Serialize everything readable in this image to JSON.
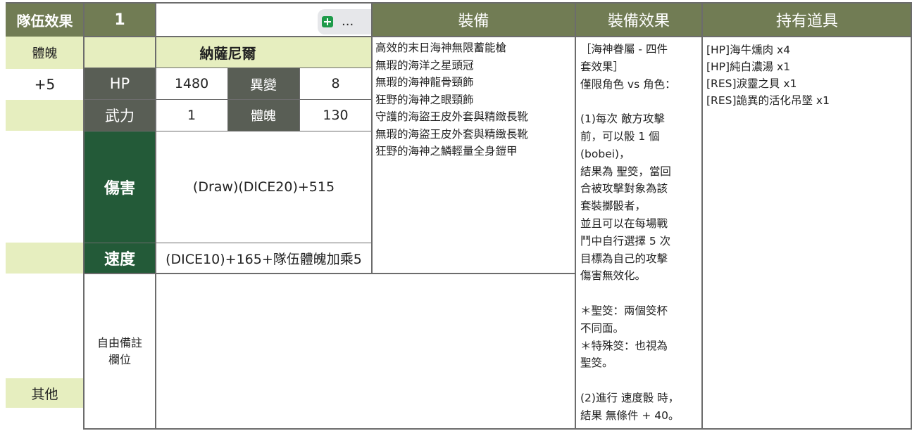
{
  "header": {
    "team_effect": "隊伍效果",
    "value": "1",
    "more": "...",
    "equipment": "裝備",
    "equip_effect": "裝備效果",
    "items": "持有道具"
  },
  "left_col": {
    "stat_label": "體魄",
    "stat_value": "+5",
    "other_label": "其他"
  },
  "character": {
    "name": "納薩尼爾",
    "hp_label": "HP",
    "hp_value": "1480",
    "mutation_label": "異變",
    "mutation_value": "8",
    "force_label": "武力",
    "force_value": "1",
    "body_label": "體魄",
    "body_value": "130",
    "damage_label": "傷害",
    "damage_value": "(Draw)(DICE20)+515",
    "speed_label": "速度",
    "speed_value": "(DICE10)+165+隊伍體魄加乘5",
    "notes_label": "自由備註\n欄位"
  },
  "equipment": [
    "高效的末日海神無限蓄能槍",
    "無瑕的海洋之星頭冠",
    "無瑕的海神龍骨頸飾",
    "狂野的海神之眼頸飾",
    "守護的海盜王皮外套與精緻長靴",
    "無瑕的海盜王皮外套與精緻長靴",
    "狂野的海神之鱗輕量全身鎧甲"
  ],
  "equip_effect_text": "［海神眷屬 - 四件\n套效果］\n僅限角色 vs 角色：\n\n(1)每次 敵方攻擊\n前，可以骰 1 個\n(bobei)，\n結果為 聖筊，當回\n合被攻擊對象為該\n套裝擲骰者，\n並且可以在每場戰\n鬥中自行選擇 5 次\n目標為自己的攻擊\n傷害無效化。\n\n＊聖筊：兩個筊杯\n不同面。\n＊特殊筊：也視為\n聖筊。\n\n(2)進行 速度骰 時，\n結果 無條件 + 40。",
  "items": [
    "[HP]海牛燻肉 x4",
    "[HP]純白濃湯 x1",
    "[RES]淚靈之貝 x1",
    "[RES]詭異的活化吊墜 x1"
  ],
  "colors": {
    "header_olive": "#717c54",
    "light_green": "#e6eebf",
    "dark_green": "#235a38",
    "gray_label": "#595e55",
    "add_icon_green": "#1e9b4a"
  }
}
